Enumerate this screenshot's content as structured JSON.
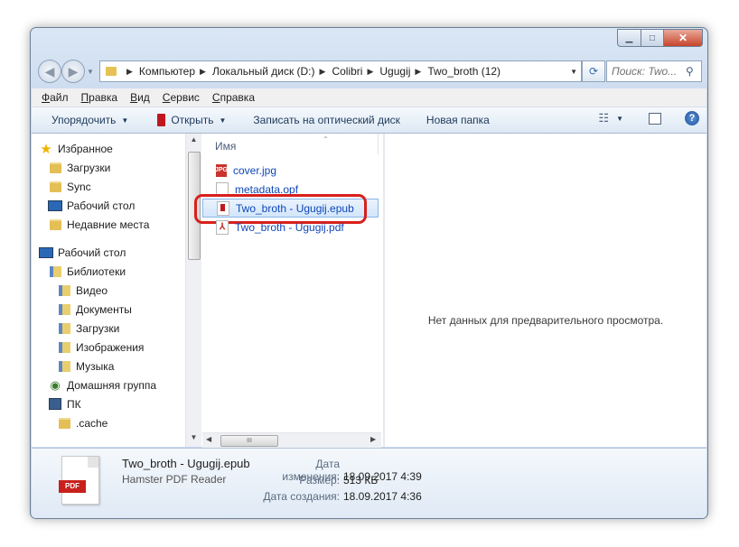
{
  "window": {
    "caption": {
      "minimize": "▁",
      "maximize": "□",
      "close": "✕"
    }
  },
  "nav": {
    "back_icon": "back-arrow-icon",
    "forward_icon": "forward-arrow-icon"
  },
  "address": {
    "crumbs": [
      "Компьютер",
      "Локальный диск (D:)",
      "Colibri",
      "Ugugij",
      "Two_broth (12)"
    ]
  },
  "search": {
    "placeholder": "Поиск: Two..."
  },
  "menu": {
    "items": [
      {
        "key": "Ф",
        "rest": "айл"
      },
      {
        "key": "П",
        "rest": "равка"
      },
      {
        "key": "В",
        "rest": "ид"
      },
      {
        "key": "С",
        "rest": "ервис"
      },
      {
        "key": "С",
        "rest": "правка"
      }
    ]
  },
  "toolbar": {
    "organize": "Упорядочить",
    "open": "Открыть",
    "burn": "Записать на оптический диск",
    "new_folder": "Новая папка"
  },
  "navtree": {
    "favorites": [
      {
        "label": "Избранное",
        "icon": "star-icon",
        "indent": 0
      },
      {
        "label": "Загрузки",
        "icon": "downloads-folder-icon",
        "indent": 1
      },
      {
        "label": "Sync",
        "icon": "folder-icon",
        "indent": 1
      },
      {
        "label": "Рабочий стол",
        "icon": "desktop-icon",
        "indent": 1
      },
      {
        "label": "Недавние места",
        "icon": "recent-places-icon",
        "indent": 1
      }
    ],
    "desktop": [
      {
        "label": "Рабочий стол",
        "icon": "desktop-icon",
        "indent": 0
      },
      {
        "label": "Библиотеки",
        "icon": "libraries-icon",
        "indent": 1
      },
      {
        "label": "Видео",
        "icon": "video-library-icon",
        "indent": 2
      },
      {
        "label": "Документы",
        "icon": "documents-library-icon",
        "indent": 2
      },
      {
        "label": "Загрузки",
        "icon": "downloads-library-icon",
        "indent": 2
      },
      {
        "label": "Изображения",
        "icon": "pictures-library-icon",
        "indent": 2
      },
      {
        "label": "Музыка",
        "icon": "music-library-icon",
        "indent": 2
      },
      {
        "label": "Домашняя группа",
        "icon": "homegroup-icon",
        "indent": 1
      },
      {
        "label": "ПК",
        "icon": "computer-icon",
        "indent": 1
      },
      {
        "label": ".cache",
        "icon": "folder-icon",
        "indent": 2
      }
    ]
  },
  "filelist": {
    "column": "Имя",
    "files": [
      {
        "name": "cover.jpg",
        "type": "jpg",
        "selected": false
      },
      {
        "name": "metadata.opf",
        "type": "opf",
        "selected": false
      },
      {
        "name": "Two_broth - Ugugij.epub",
        "type": "epub",
        "selected": true
      },
      {
        "name": "Two_broth - Ugugij.pdf",
        "type": "pdf",
        "selected": false
      }
    ],
    "scroll_thumb": "III"
  },
  "preview": {
    "message": "Нет данных для предварительного просмотра."
  },
  "details": {
    "filename": "Two_broth - Ugugij.epub",
    "app": "Hamster PDF Reader",
    "icon_label": "PDF",
    "modified_label": "Дата изменения:",
    "modified_value": "18.09.2017 4:39",
    "size_label": "Размер:",
    "size_value": "513 КБ",
    "created_label": "Дата создания:",
    "created_value": "18.09.2017 4:36"
  },
  "colors": {
    "highlight": "#d8201b",
    "link": "#0f47b8"
  }
}
